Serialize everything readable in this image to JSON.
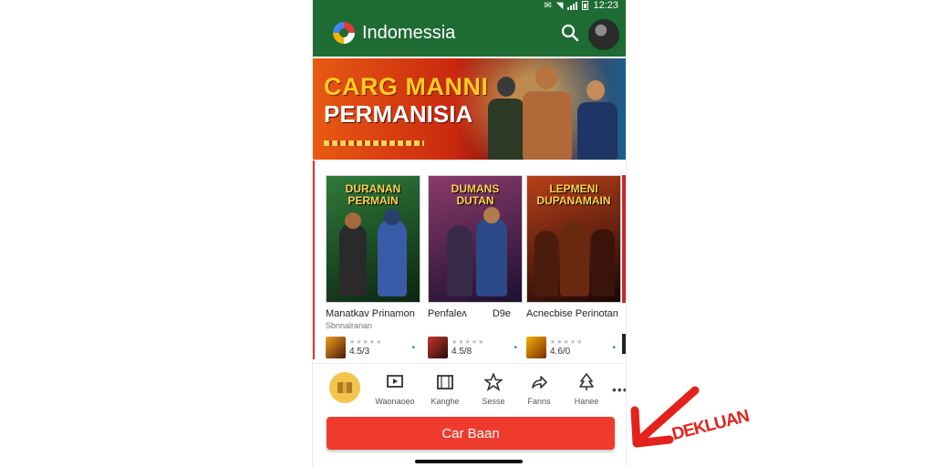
{
  "status_bar": {
    "time": "12:23"
  },
  "app_bar": {
    "title": "Indomessia"
  },
  "banner": {
    "title_line_1": "CARG MANNI",
    "title_line_2": "PERMANISIA"
  },
  "games": [
    {
      "cover_title": "DURANAN PERMAIN",
      "title": "Manatkav Pɾinamon",
      "subtitle": "Sbnnalranan",
      "rating": "4.5/3",
      "cover_colors": [
        "#1d5a26",
        "#0d2512"
      ]
    },
    {
      "cover_title": "DUMANS DUTAN",
      "title": "Penfaleʌ",
      "subtitle": "",
      "extra": "D9e",
      "rating": "4.5/8",
      "cover_colors": [
        "#7a2a5a",
        "#261236"
      ]
    },
    {
      "cover_title": "LEPMENI DUPANAMAIN",
      "title": "Acnecbise Peɾinotan",
      "subtitle": "",
      "rating": "4.6/0",
      "cover_colors": [
        "#8a2812",
        "#2a0a08"
      ]
    }
  ],
  "bottom_nav": [
    {
      "label": "Waonaoeo",
      "icon": "tv-icon"
    },
    {
      "label": "Kanghe",
      "icon": "film-icon"
    },
    {
      "label": "Sesse",
      "icon": "star-icon"
    },
    {
      "label": "Fanns",
      "icon": "share-icon"
    },
    {
      "label": "Hanee",
      "icon": "tree-icon"
    }
  ],
  "cta": {
    "label": "Car Baan"
  },
  "annotation": {
    "label": "DEKLUAN",
    "color": "#e3231b"
  }
}
